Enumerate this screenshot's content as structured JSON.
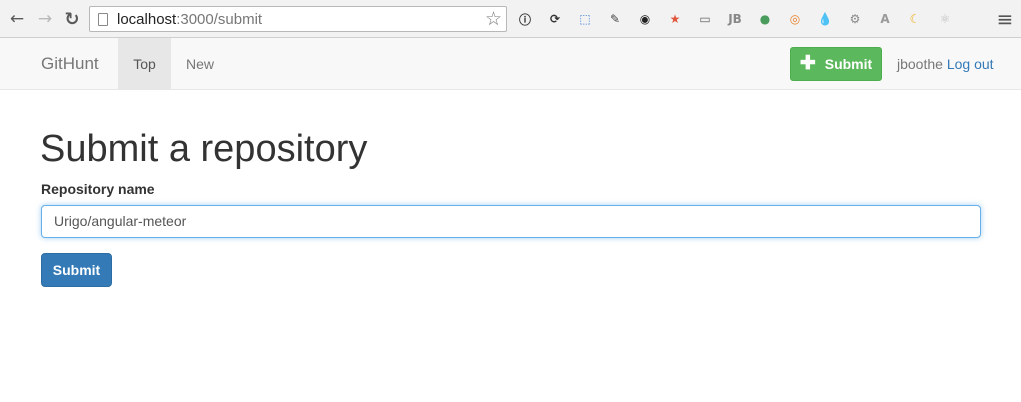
{
  "browser": {
    "back_glyph": "←",
    "forward_glyph": "→",
    "reload_glyph": "↻",
    "url_host": "localhost",
    "url_path": ":3000/submit",
    "star_glyph": "☆",
    "menu_glyph": "≡",
    "extensions": [
      {
        "name": "info-extension-icon",
        "glyph": "ⓘ",
        "color": "#333333"
      },
      {
        "name": "sync-extension-icon",
        "glyph": "⟳",
        "color": "#333333"
      },
      {
        "name": "screenshot-extension-icon",
        "glyph": "⬚",
        "color": "#3b7ad6"
      },
      {
        "name": "eyedropper-extension-icon",
        "glyph": "✎",
        "color": "#444444"
      },
      {
        "name": "color-wheel-extension-icon",
        "glyph": "◉",
        "color": "#222222"
      },
      {
        "name": "star-badge-extension-icon",
        "glyph": "★",
        "color": "#e0553b"
      },
      {
        "name": "cast-extension-icon",
        "glyph": "▭",
        "color": "#666666"
      },
      {
        "name": "jetbrains-extension-icon",
        "glyph": "JB",
        "color": "#888888"
      },
      {
        "name": "globe-extension-icon",
        "glyph": "●",
        "color": "#4a9c5c"
      },
      {
        "name": "lifebuoy-extension-icon",
        "glyph": "◎",
        "color": "#e8822c"
      },
      {
        "name": "drop-extension-icon",
        "glyph": "💧",
        "color": "#2b8fd6"
      },
      {
        "name": "plugin-extension-icon",
        "glyph": "⚙",
        "color": "#888888"
      },
      {
        "name": "font-extension-icon",
        "glyph": "A",
        "color": "#9a9a9a"
      },
      {
        "name": "moon-extension-icon",
        "glyph": "☾",
        "color": "#f2b01e"
      },
      {
        "name": "react-extension-icon",
        "glyph": "⚛",
        "color": "#bfbfbf"
      }
    ]
  },
  "navbar": {
    "brand": "GitHunt",
    "tabs": [
      {
        "label": "Top",
        "active": true
      },
      {
        "label": "New",
        "active": false
      }
    ],
    "submit_label": "Submit",
    "submit_icon": "✚",
    "username": "jboothe",
    "logout_label": "Log out"
  },
  "main": {
    "title": "Submit a repository",
    "field_label": "Repository name",
    "repo_value": "Urigo/angular-meteor",
    "submit_label": "Submit"
  },
  "colors": {
    "success": "#5cb85c",
    "primary": "#337ab7",
    "focus": "#66afe9"
  }
}
